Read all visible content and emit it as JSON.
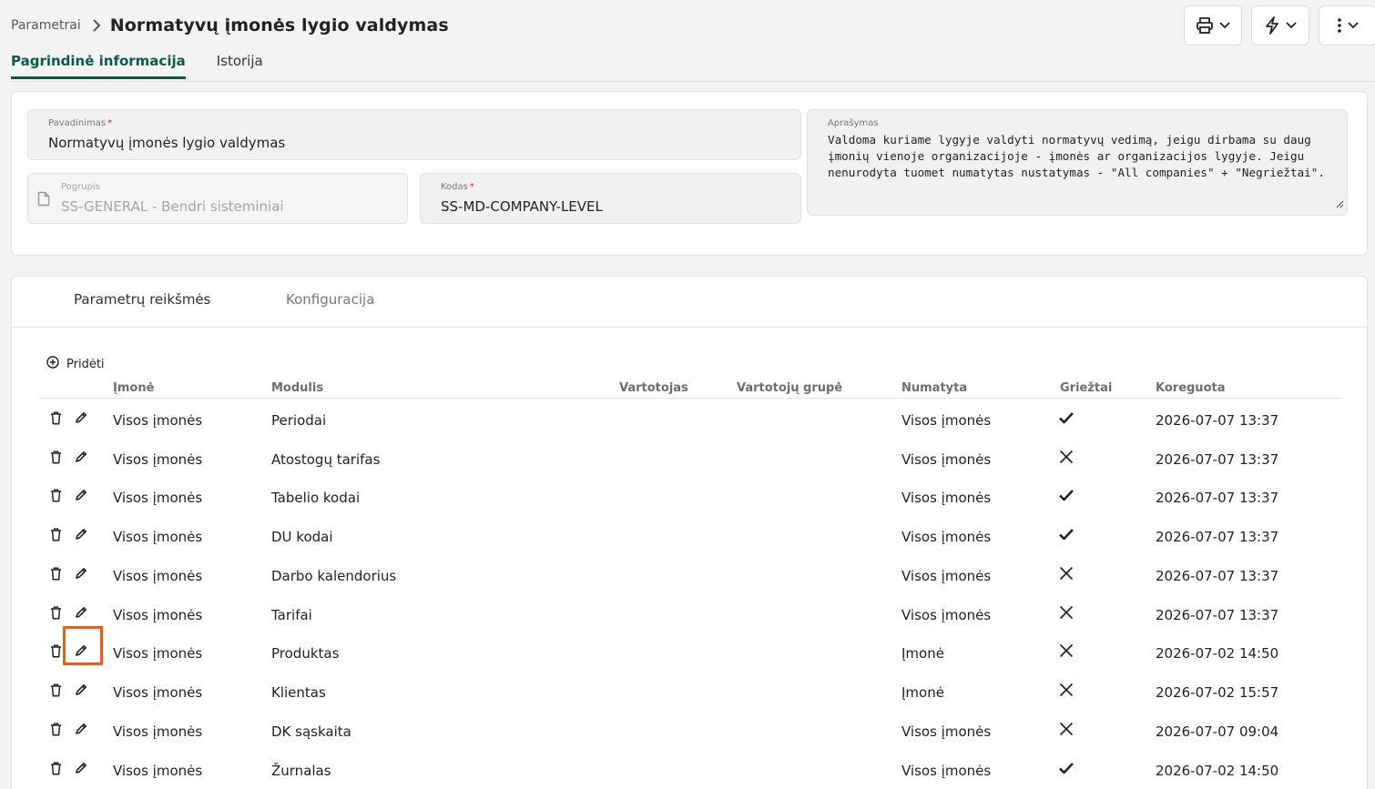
{
  "breadcrumb": {
    "parent": "Parametrai",
    "title": "Normatyvų įmonės lygio valdymas"
  },
  "toolbar": {
    "print_icon": "printer-icon",
    "actions_icon": "lightning-icon",
    "more_icon": "more-vertical-icon"
  },
  "tabs": [
    {
      "label": "Pagrindinė informacija",
      "active": true
    },
    {
      "label": "Istorija",
      "active": false
    }
  ],
  "form": {
    "pavadinimas": {
      "label": "Pavadinimas",
      "value": "Normatyvų įmonės lygio valdymas",
      "required": "*"
    },
    "pogrupis": {
      "label": "Pogrupis",
      "value": "SS-GENERAL - Bendri sisteminiai",
      "disabled": true
    },
    "kodas": {
      "label": "Kodas",
      "value": "SS-MD-COMPANY-LEVEL",
      "required": "*"
    },
    "aprasymas": {
      "label": "Aprašymas",
      "value": "Valdoma kuriame lygyje valdyti normatyvų vedimą, jeigu dirbama su daug įmonių vienoje organizacijoje - įmonės ar organizacijos lygyje. Jeigu nenurodyta tuomet numatytas nustatymas - \"All companies\" + \"Negriežtai\"."
    }
  },
  "subtabs": [
    {
      "label": "Parametrų reikšmės",
      "active": true
    },
    {
      "label": "Konfiguracija",
      "active": false
    }
  ],
  "add_label": "Pridėti",
  "table": {
    "columns": [
      "Įmonė",
      "Modulis",
      "Vartotojas",
      "Vartotojų grupė",
      "Numatyta",
      "Griežtai",
      "Koreguota"
    ],
    "rows": [
      {
        "imone": "Visos įmonės",
        "modulis": "Periodai",
        "vartotojas": "",
        "grupe": "",
        "numatyta": "Visos įmonės",
        "griezta": true,
        "koreguota": "2026-07-07 13:37"
      },
      {
        "imone": "Visos įmonės",
        "modulis": "Atostogų tarifas",
        "vartotojas": "",
        "grupe": "",
        "numatyta": "Visos įmonės",
        "griezta": false,
        "koreguota": "2026-07-07 13:37"
      },
      {
        "imone": "Visos įmonės",
        "modulis": "Tabelio kodai",
        "vartotojas": "",
        "grupe": "",
        "numatyta": "Visos įmonės",
        "griezta": true,
        "koreguota": "2026-07-07 13:37"
      },
      {
        "imone": "Visos įmonės",
        "modulis": "DU kodai",
        "vartotojas": "",
        "grupe": "",
        "numatyta": "Visos įmonės",
        "griezta": true,
        "koreguota": "2026-07-07 13:37"
      },
      {
        "imone": "Visos įmonės",
        "modulis": "Darbo kalendorius",
        "vartotojas": "",
        "grupe": "",
        "numatyta": "Visos įmonės",
        "griezta": false,
        "koreguota": "2026-07-07 13:37"
      },
      {
        "imone": "Visos įmonės",
        "modulis": "Tarifai",
        "vartotojas": "",
        "grupe": "",
        "numatyta": "Visos įmonės",
        "griezta": false,
        "koreguota": "2026-07-07 13:37"
      },
      {
        "imone": "Visos įmonės",
        "modulis": "Produktas",
        "vartotojas": "",
        "grupe": "",
        "numatyta": "Įmonė",
        "griezta": false,
        "koreguota": "2026-07-02 14:50",
        "highlighted": true
      },
      {
        "imone": "Visos įmonės",
        "modulis": "Klientas",
        "vartotojas": "",
        "grupe": "",
        "numatyta": "Įmonė",
        "griezta": false,
        "koreguota": "2026-07-02 15:57"
      },
      {
        "imone": "Visos įmonės",
        "modulis": "DK sąskaita",
        "vartotojas": "",
        "grupe": "",
        "numatyta": "Visos įmonės",
        "griezta": false,
        "koreguota": "2026-07-07 09:04"
      },
      {
        "imone": "Visos įmonės",
        "modulis": "Žurnalas",
        "vartotojas": "",
        "grupe": "",
        "numatyta": "Visos įmonės",
        "griezta": true,
        "koreguota": "2026-07-02 14:50"
      }
    ]
  },
  "colors": {
    "accent": "#0c5b45",
    "highlight": "#f05a14",
    "required": "#c62828"
  }
}
